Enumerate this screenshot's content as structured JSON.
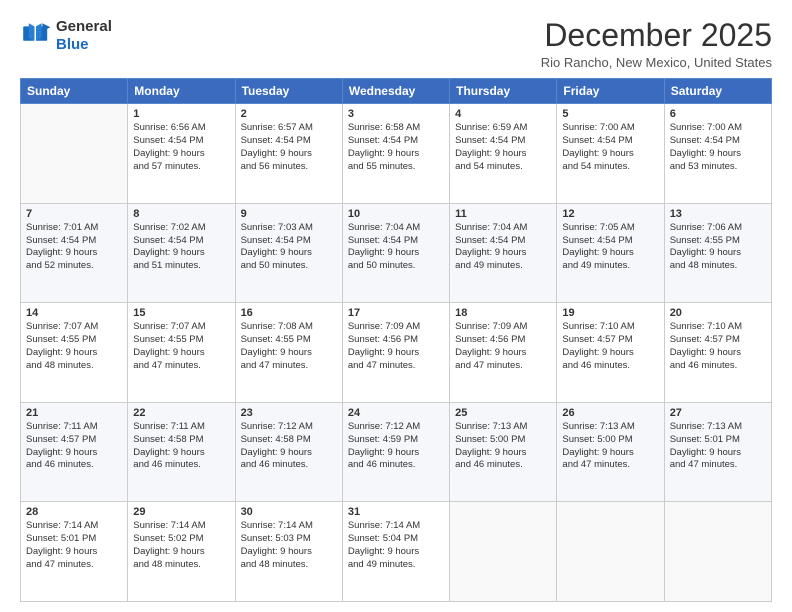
{
  "logo": {
    "line1": "General",
    "line2": "Blue"
  },
  "title": "December 2025",
  "location": "Rio Rancho, New Mexico, United States",
  "weekdays": [
    "Sunday",
    "Monday",
    "Tuesday",
    "Wednesday",
    "Thursday",
    "Friday",
    "Saturday"
  ],
  "weeks": [
    [
      {
        "day": "",
        "info": ""
      },
      {
        "day": "1",
        "info": "Sunrise: 6:56 AM\nSunset: 4:54 PM\nDaylight: 9 hours\nand 57 minutes."
      },
      {
        "day": "2",
        "info": "Sunrise: 6:57 AM\nSunset: 4:54 PM\nDaylight: 9 hours\nand 56 minutes."
      },
      {
        "day": "3",
        "info": "Sunrise: 6:58 AM\nSunset: 4:54 PM\nDaylight: 9 hours\nand 55 minutes."
      },
      {
        "day": "4",
        "info": "Sunrise: 6:59 AM\nSunset: 4:54 PM\nDaylight: 9 hours\nand 54 minutes."
      },
      {
        "day": "5",
        "info": "Sunrise: 7:00 AM\nSunset: 4:54 PM\nDaylight: 9 hours\nand 54 minutes."
      },
      {
        "day": "6",
        "info": "Sunrise: 7:00 AM\nSunset: 4:54 PM\nDaylight: 9 hours\nand 53 minutes."
      }
    ],
    [
      {
        "day": "7",
        "info": "Sunrise: 7:01 AM\nSunset: 4:54 PM\nDaylight: 9 hours\nand 52 minutes."
      },
      {
        "day": "8",
        "info": "Sunrise: 7:02 AM\nSunset: 4:54 PM\nDaylight: 9 hours\nand 51 minutes."
      },
      {
        "day": "9",
        "info": "Sunrise: 7:03 AM\nSunset: 4:54 PM\nDaylight: 9 hours\nand 50 minutes."
      },
      {
        "day": "10",
        "info": "Sunrise: 7:04 AM\nSunset: 4:54 PM\nDaylight: 9 hours\nand 50 minutes."
      },
      {
        "day": "11",
        "info": "Sunrise: 7:04 AM\nSunset: 4:54 PM\nDaylight: 9 hours\nand 49 minutes."
      },
      {
        "day": "12",
        "info": "Sunrise: 7:05 AM\nSunset: 4:54 PM\nDaylight: 9 hours\nand 49 minutes."
      },
      {
        "day": "13",
        "info": "Sunrise: 7:06 AM\nSunset: 4:55 PM\nDaylight: 9 hours\nand 48 minutes."
      }
    ],
    [
      {
        "day": "14",
        "info": "Sunrise: 7:07 AM\nSunset: 4:55 PM\nDaylight: 9 hours\nand 48 minutes."
      },
      {
        "day": "15",
        "info": "Sunrise: 7:07 AM\nSunset: 4:55 PM\nDaylight: 9 hours\nand 47 minutes."
      },
      {
        "day": "16",
        "info": "Sunrise: 7:08 AM\nSunset: 4:55 PM\nDaylight: 9 hours\nand 47 minutes."
      },
      {
        "day": "17",
        "info": "Sunrise: 7:09 AM\nSunset: 4:56 PM\nDaylight: 9 hours\nand 47 minutes."
      },
      {
        "day": "18",
        "info": "Sunrise: 7:09 AM\nSunset: 4:56 PM\nDaylight: 9 hours\nand 47 minutes."
      },
      {
        "day": "19",
        "info": "Sunrise: 7:10 AM\nSunset: 4:57 PM\nDaylight: 9 hours\nand 46 minutes."
      },
      {
        "day": "20",
        "info": "Sunrise: 7:10 AM\nSunset: 4:57 PM\nDaylight: 9 hours\nand 46 minutes."
      }
    ],
    [
      {
        "day": "21",
        "info": "Sunrise: 7:11 AM\nSunset: 4:57 PM\nDaylight: 9 hours\nand 46 minutes."
      },
      {
        "day": "22",
        "info": "Sunrise: 7:11 AM\nSunset: 4:58 PM\nDaylight: 9 hours\nand 46 minutes."
      },
      {
        "day": "23",
        "info": "Sunrise: 7:12 AM\nSunset: 4:58 PM\nDaylight: 9 hours\nand 46 minutes."
      },
      {
        "day": "24",
        "info": "Sunrise: 7:12 AM\nSunset: 4:59 PM\nDaylight: 9 hours\nand 46 minutes."
      },
      {
        "day": "25",
        "info": "Sunrise: 7:13 AM\nSunset: 5:00 PM\nDaylight: 9 hours\nand 46 minutes."
      },
      {
        "day": "26",
        "info": "Sunrise: 7:13 AM\nSunset: 5:00 PM\nDaylight: 9 hours\nand 47 minutes."
      },
      {
        "day": "27",
        "info": "Sunrise: 7:13 AM\nSunset: 5:01 PM\nDaylight: 9 hours\nand 47 minutes."
      }
    ],
    [
      {
        "day": "28",
        "info": "Sunrise: 7:14 AM\nSunset: 5:01 PM\nDaylight: 9 hours\nand 47 minutes."
      },
      {
        "day": "29",
        "info": "Sunrise: 7:14 AM\nSunset: 5:02 PM\nDaylight: 9 hours\nand 48 minutes."
      },
      {
        "day": "30",
        "info": "Sunrise: 7:14 AM\nSunset: 5:03 PM\nDaylight: 9 hours\nand 48 minutes."
      },
      {
        "day": "31",
        "info": "Sunrise: 7:14 AM\nSunset: 5:04 PM\nDaylight: 9 hours\nand 49 minutes."
      },
      {
        "day": "",
        "info": ""
      },
      {
        "day": "",
        "info": ""
      },
      {
        "day": "",
        "info": ""
      }
    ]
  ]
}
